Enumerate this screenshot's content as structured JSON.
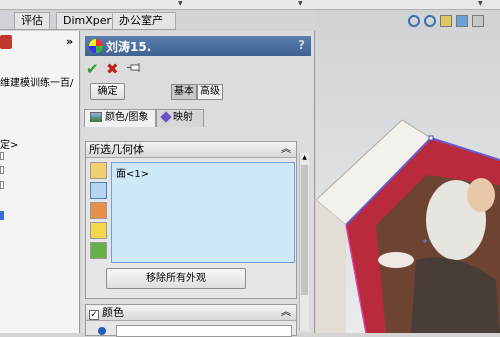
{
  "tabs": [
    "评估",
    "DimXpert",
    "办公室产品"
  ],
  "left_panel": {
    "chevron": "»",
    "tree_items": [
      "维建模训练一百/",
      "定>"
    ]
  },
  "pm": {
    "title": "刘涛15.",
    "help": "?",
    "confirm_button": "确定",
    "mode_basic": "基本",
    "mode_advanced": "高级",
    "tab_color": "颜色/图象",
    "tab_mapping": "映射",
    "sel_geometry_title": "所选几何体",
    "sel_geometry_chevron": "︽",
    "selection_items": [
      "面<1>"
    ],
    "remove_button": "移除所有外观",
    "color_section_title": "颜色",
    "color_section_chevron": "︽"
  },
  "colors": {
    "titlebar": "#4a6fa0",
    "selection_bg": "#cfe8f8",
    "model_edge": "#6a5acd",
    "floral_red": "#b82a3c",
    "foliage_green": "#2f5a2a"
  }
}
